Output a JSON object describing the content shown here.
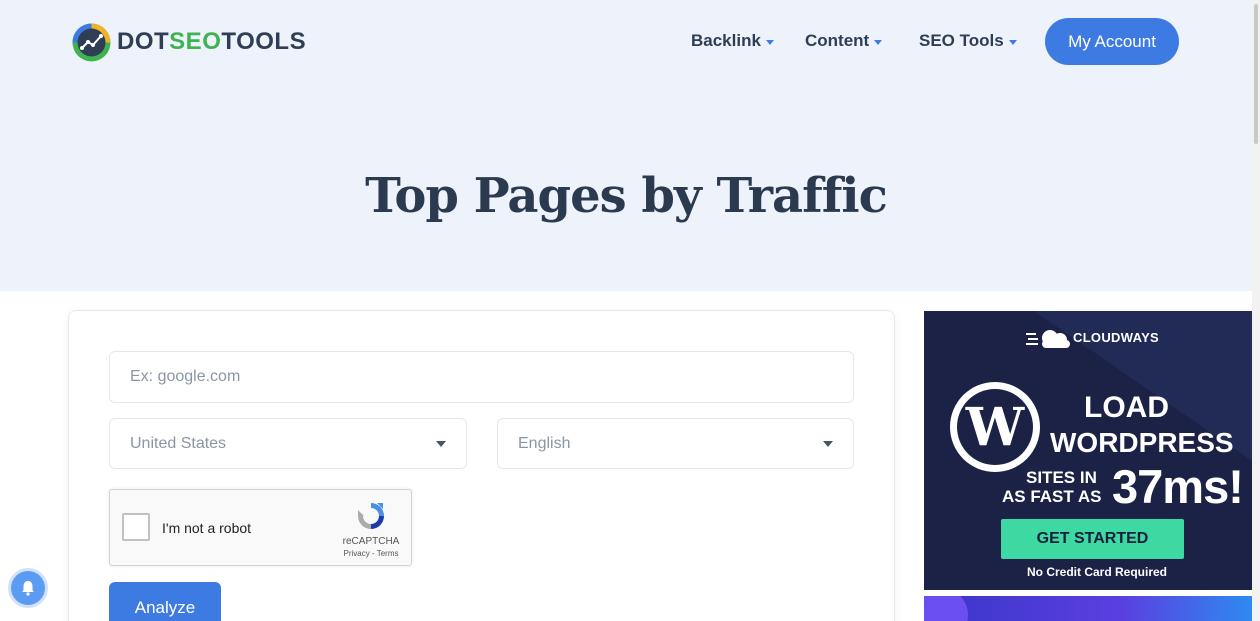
{
  "logo": {
    "text_part1": "DOT",
    "text_part2": "SEO",
    "text_part3": "TOOLS"
  },
  "nav": {
    "items": [
      {
        "label": "Backlink"
      },
      {
        "label": "Content"
      },
      {
        "label": "SEO Tools"
      }
    ],
    "account_label": "My Account"
  },
  "page": {
    "title": "Top Pages by Traffic"
  },
  "form": {
    "domain_placeholder": "Ex: google.com",
    "country_value": "United States",
    "language_value": "English",
    "analyze_label": "Analyze"
  },
  "recaptcha": {
    "label": "I'm not a robot",
    "brand": "reCAPTCHA",
    "terms": "Privacy - Terms"
  },
  "ad": {
    "brand": "CLOUDWAYS",
    "line1": "LOAD",
    "line2": "WORDPRESS",
    "line3": "SITES IN",
    "line4": "AS FAST AS",
    "highlight": "37ms!",
    "cta": "GET STARTED",
    "footnote": "No Credit Card Required"
  },
  "colors": {
    "accent": "#3d7be3",
    "hero_bg": "#eef3fb",
    "logo_green": "#3fb34f",
    "ad_bg": "#1b2246",
    "ad_cta": "#3ed9a2"
  },
  "icons": [
    "logo-mark-icon",
    "caret-down-icon",
    "recaptcha-icon",
    "notification-bell-icon",
    "cloudways-icon",
    "wordpress-icon"
  ]
}
